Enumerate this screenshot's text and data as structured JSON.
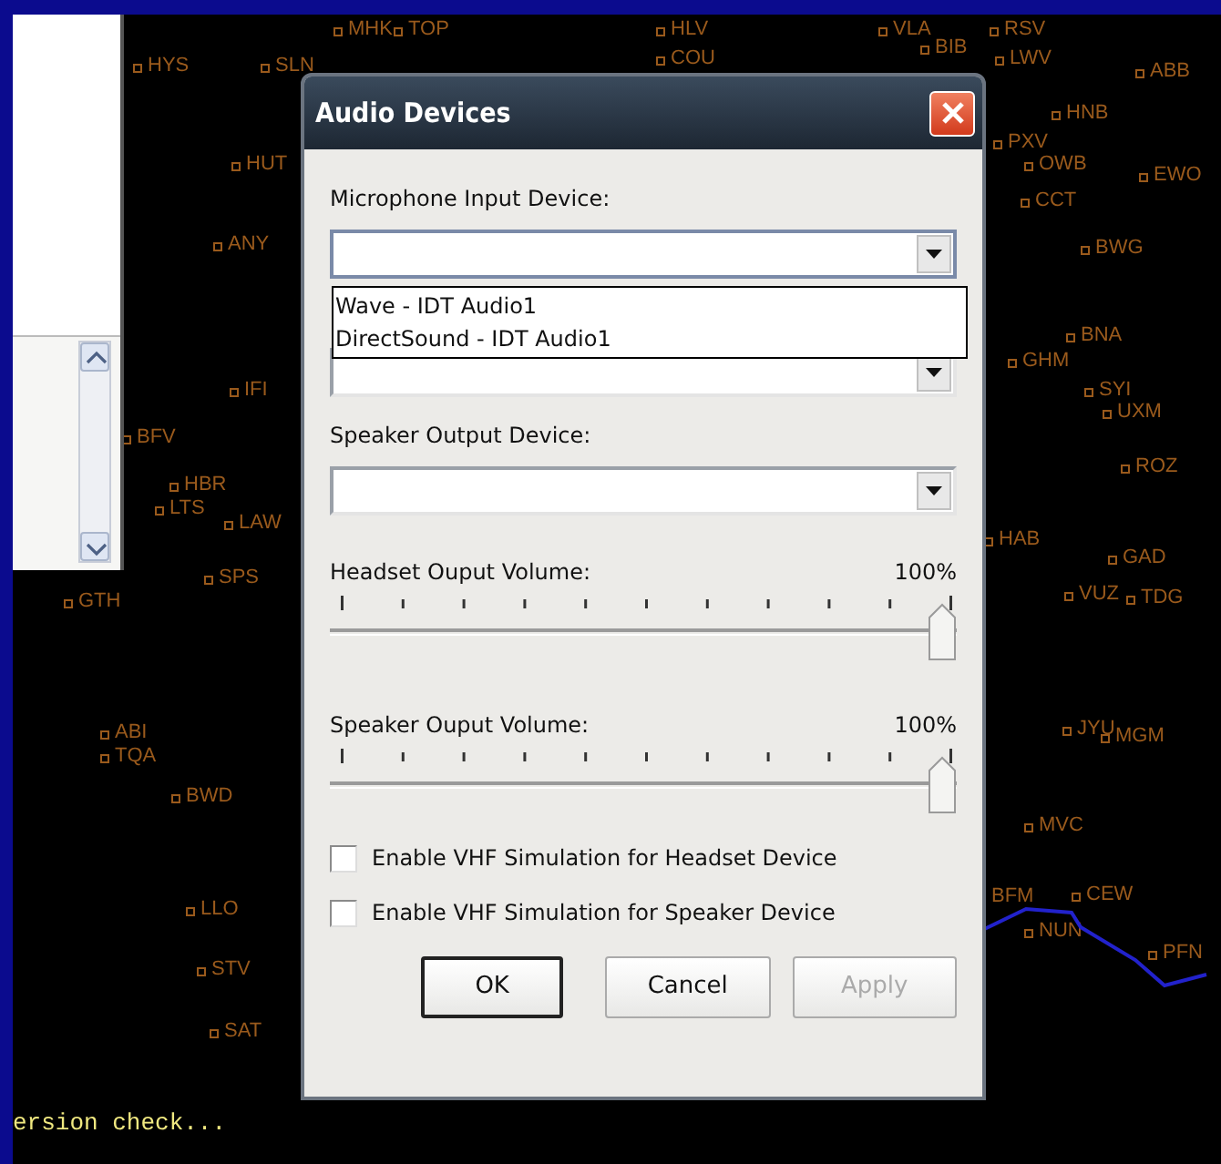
{
  "map": {
    "labels": [
      "HYS",
      "SLN",
      "MHK",
      "TOP",
      "HLV",
      "COU",
      "VLA",
      "BIB",
      "RSV",
      "LWV",
      "ABB",
      "HNB",
      "PXV",
      "OWB",
      "EWO",
      "CCT",
      "BWG",
      "BNA",
      "GHM",
      "SYI",
      "UXM",
      "ROZ",
      "HAB",
      "GAD",
      "VUZ",
      "TDG",
      "JYU",
      "MGM",
      "MVC",
      "CEW",
      "BFM",
      "NUN",
      "PFN",
      "HUT",
      "ANY",
      "IFI",
      "BFV",
      "HBR",
      "LTS",
      "LAW",
      "SPS",
      "GTH",
      "ABI",
      "TQA",
      "BWD",
      "LLO",
      "STV",
      "SAT"
    ]
  },
  "console": {
    "lines": [
      "ersion check..."
    ]
  },
  "dialog": {
    "title": "Audio Devices",
    "selects": [
      {
        "label": "Microphone Input Device:",
        "open": true,
        "options": [
          "Wave - IDT Audio1",
          "DirectSound - IDT Audio1"
        ]
      },
      {
        "open": false
      },
      {
        "label": "Speaker Output Device:",
        "open": false
      }
    ],
    "volumes": [
      {
        "label": "Headset Ouput Volume:",
        "reading": "100%",
        "level": 1
      },
      {
        "label": "Speaker Ouput Volume:",
        "reading": "100%",
        "level": 1
      }
    ],
    "checkboxes": [
      {
        "label": "Enable VHF Simulation for Headset Device",
        "checked": false
      },
      {
        "label": "Enable VHF Simulation for Speaker Device",
        "checked": false
      }
    ],
    "buttons": [
      {
        "label": "OK",
        "default": true,
        "disabled": false
      },
      {
        "label": "Cancel",
        "default": false,
        "disabled": false
      },
      {
        "label": "Apply",
        "default": false,
        "disabled": true
      }
    ]
  }
}
